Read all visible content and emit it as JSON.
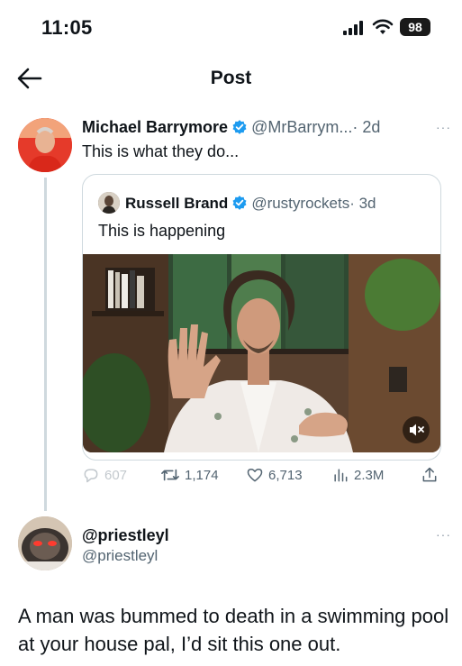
{
  "status_bar": {
    "time": "11:05",
    "battery": "98"
  },
  "nav": {
    "title": "Post"
  },
  "tweet": {
    "author_name": "Michael Barrymore",
    "author_handle": "@MrBarrym...",
    "time": "· 2d",
    "text": "This is what they do...",
    "more": "···"
  },
  "quote": {
    "author_name": "Russell Brand",
    "author_handle": "@rustyrockets",
    "time": "· 3d",
    "text": "This is happening"
  },
  "actions": {
    "replies": "607",
    "reposts": "1,174",
    "likes": "6,713",
    "views": "2.3M"
  },
  "reply": {
    "name": "@priestleyl",
    "handle": "@priestleyl",
    "text": "A man was bummed to death in a swimming pool at your house pal, I’d sit this one out.",
    "more": "···"
  },
  "colors": {
    "verified": "#1d9bf0",
    "secondary_text": "#536471",
    "divider": "#cfd9de"
  }
}
